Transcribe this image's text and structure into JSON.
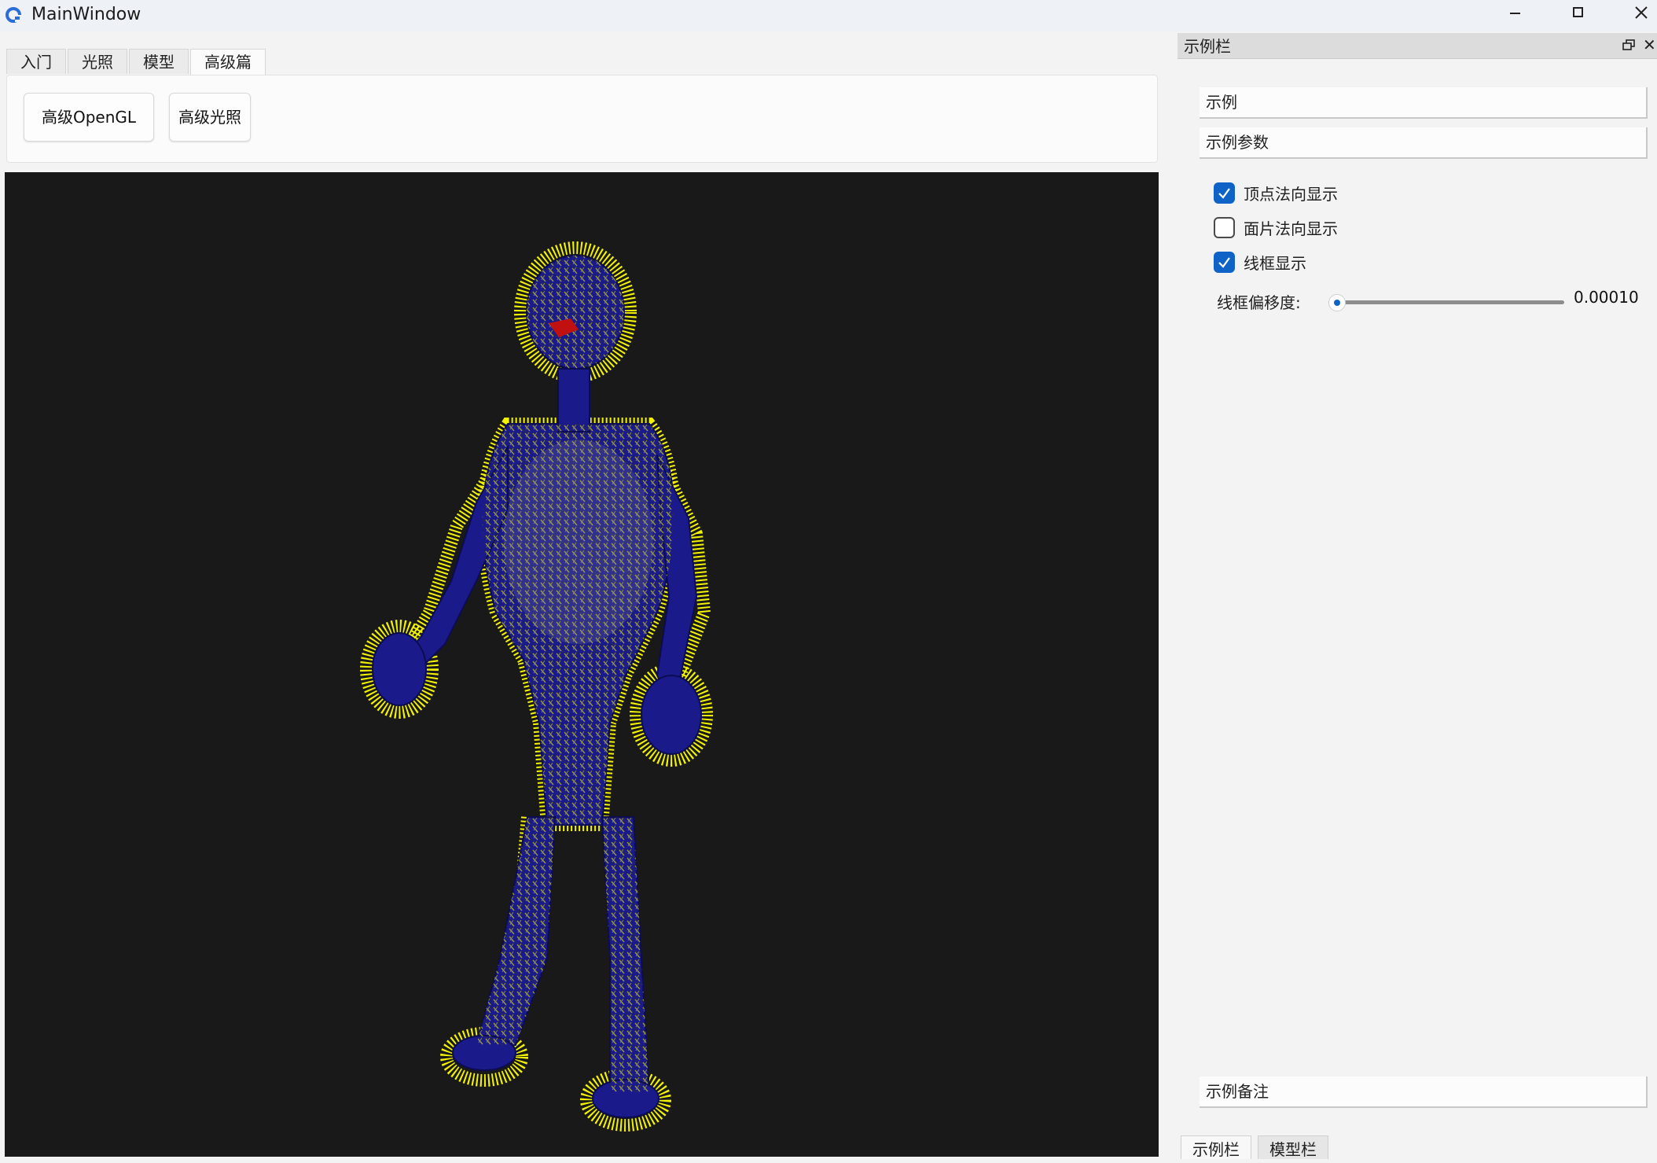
{
  "window": {
    "title": "MainWindow"
  },
  "tabs": [
    {
      "label": "入门",
      "active": false
    },
    {
      "label": "光照",
      "active": false
    },
    {
      "label": "模型",
      "active": false
    },
    {
      "label": "高级篇",
      "active": true
    }
  ],
  "tab_panel": {
    "buttons": [
      {
        "label": "高级OpenGL"
      },
      {
        "label": "高级光照"
      }
    ]
  },
  "viewport": {
    "background": "#191919",
    "model_colors": {
      "body": "#1a1a8a",
      "normals": "#ffff00",
      "wireframe": "#3a3a3a"
    },
    "show_vertex_normals": true,
    "show_face_normals": false,
    "show_wireframe": true
  },
  "dock": {
    "title": "示例栏",
    "sections": {
      "examples": "示例",
      "params": "示例参数",
      "notes": "示例备注"
    },
    "options": [
      {
        "label": "顶点法向显示",
        "checked": true
      },
      {
        "label": "面片法向显示",
        "checked": false
      },
      {
        "label": "线框显示",
        "checked": true
      }
    ],
    "slider": {
      "label": "线框偏移度:",
      "value": "0.00010",
      "level": 0.01
    },
    "bottom_tabs": [
      {
        "label": "示例栏",
        "active": true
      },
      {
        "label": "模型栏",
        "active": false
      }
    ]
  },
  "icons": {
    "app": "app-logo-icon",
    "minimize": "minimize-icon",
    "maximize": "maximize-icon",
    "close": "close-icon",
    "float": "float-panel-icon",
    "dock_close": "dock-close-icon",
    "check": "checkmark-icon"
  },
  "colors": {
    "accent": "#0f63c6",
    "titlebar": "#eef1f6"
  }
}
